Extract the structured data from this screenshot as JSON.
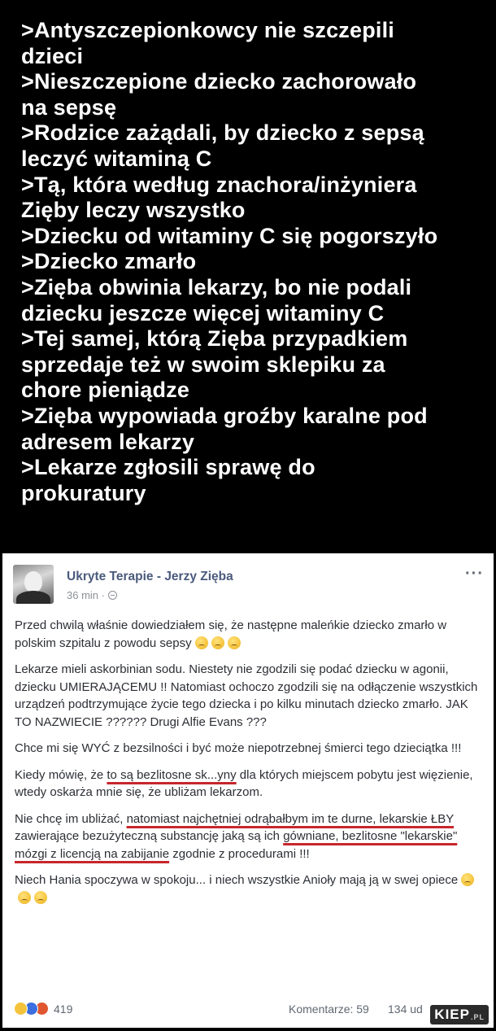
{
  "greentext": {
    "lines": [
      ">Antyszczepionkowcy nie szczepili",
      "dzieci",
      ">Nieszczepione dziecko zachorowało",
      "na sepsę",
      ">Rodzice zażądali, by dziecko z sepsą",
      "leczyć witaminą C",
      ">Tą, która według znachora/inżyniera",
      "Zięby leczy wszystko",
      ">Dziecku od witaminy C się pogorszyło",
      ">Dziecko zmarło",
      ">Zięba obwinia lekarzy, bo nie podali",
      "dziecku jeszcze więcej witaminy C",
      ">Tej samej, którą Zięba przypadkiem",
      "sprzedaje też w swoim sklepiku za",
      "chore pieniądze",
      ">Zięba wypowiada groźby karalne pod",
      "adresem lekarzy",
      ">Lekarze zgłosili sprawę do",
      "prokuratury"
    ]
  },
  "post": {
    "author": "Ukryte Terapie - Jerzy Zięba",
    "time": "36 min ·",
    "more_options": "···",
    "paragraphs": {
      "p1": "Przed chwilą właśnie dowiedziałem się, że następne maleńkie dziecko zmarło w polskim szpitalu z powodu sepsy",
      "p2": "Lekarze mieli askorbinian sodu. Niestety nie zgodzili się podać dziecku w agonii, dziecku UMIERAJĄCEMU !! Natomiast ochoczo zgodzili się na odłączenie wszystkich urządzeń podtrzymujące życie tego dziecka i po kilku minutach dziecko zmarło. JAK TO NAZWIECIE ?????? Drugi Alfie Evans ???",
      "p3": "Chce mi się WYĆ z bezsilności i być może niepotrzebnej śmierci tego dzieciątka !!!",
      "p4_a": "Kiedy mówię, że ",
      "p4_u1": "to są bezlitosne sk...yny",
      "p4_b": " dla których miejscem pobytu jest więzienie, wtedy oskarża mnie się, że ubliżam lekarzom.",
      "p5_a": "Nie chcę im ubliżać, ",
      "p5_u1": "natomiast najchętniej odrąbałbym im te durne, lekarskie ŁBY",
      "p5_b": " zawierające bezużyteczną substancję jaką są ich ",
      "p5_u2": "gówniane, bezlitosne \"lekarskie\" mózgi z licencją na zabijanie",
      "p5_c": " zgodnie z procedurami !!!",
      "p6": "Niech Hania spoczywa w spokoju... i niech wszystkie Anioły mają ją w swej opiece"
    },
    "emoji_names": [
      "sad-face-emoji",
      "sad-face-emoji",
      "sad-face-emoji"
    ],
    "reaction_count": "419",
    "comments": "Komentarze: 59",
    "shares": "134 ud"
  },
  "watermark": {
    "text": "KIEP",
    "suffix": ".PL"
  },
  "colors": {
    "background_top": "#000000",
    "greentext_color": "#ffffff",
    "post_background": "#ffffff",
    "author_color": "#4a5a7c",
    "underline_red": "#c7262d"
  }
}
